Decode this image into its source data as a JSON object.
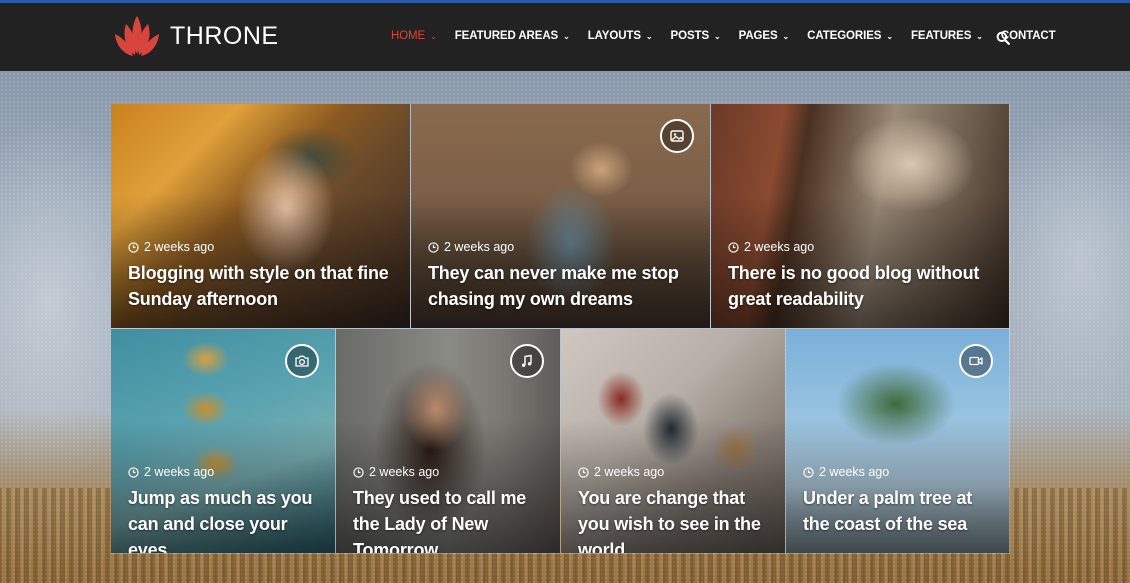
{
  "brand": {
    "name": "THRONE",
    "accent": "#d8453c"
  },
  "nav": {
    "items": [
      {
        "label": "HOME",
        "dropdown": true
      },
      {
        "label": "FEATURED AREAS",
        "dropdown": true
      },
      {
        "label": "LAYOUTS",
        "dropdown": true
      },
      {
        "label": "POSTS",
        "dropdown": true
      },
      {
        "label": "PAGES",
        "dropdown": true
      },
      {
        "label": "CATEGORIES",
        "dropdown": true
      },
      {
        "label": "FEATURES",
        "dropdown": true
      },
      {
        "label": "CONTACT",
        "dropdown": false
      }
    ],
    "active": "HOME",
    "search_icon": "search-icon"
  },
  "posts": [
    {
      "time": "2 weeks ago",
      "title": "Blogging with style on that fine Sunday afternoon",
      "format_icon": ""
    },
    {
      "time": "2 weeks ago",
      "title": "They can never make me stop chasing my own dreams",
      "format_icon": "image-icon"
    },
    {
      "time": "2 weeks ago",
      "title": "There is no good blog without great readability",
      "format_icon": ""
    },
    {
      "time": "2 weeks ago",
      "title": "Jump as much as you can and close your eyes",
      "format_icon": "camera-icon"
    },
    {
      "time": "2 weeks ago",
      "title": "They used to call me the Lady of New Tomorrow",
      "format_icon": "music-icon"
    },
    {
      "time": "2 weeks ago",
      "title": "You are change that you wish to see in the world",
      "format_icon": ""
    },
    {
      "time": "2 weeks ago",
      "title": "Under a palm tree at the coast of the sea",
      "format_icon": "video-icon"
    }
  ]
}
